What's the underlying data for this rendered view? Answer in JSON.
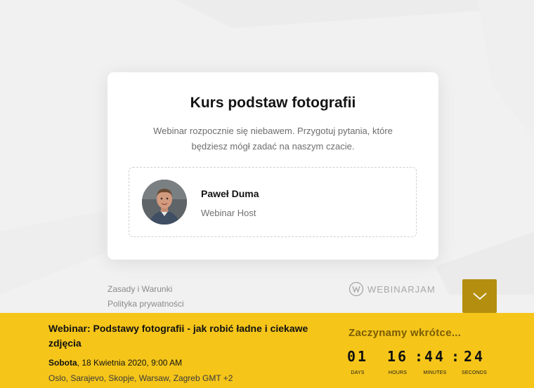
{
  "card": {
    "title": "Kurs podstaw fotografii",
    "description": "Webinar rozpocznie się niebawem. Przygotuj pytania, które będziesz mógł zadać na naszym czacie."
  },
  "host": {
    "name": "Paweł Duma",
    "role": "Webinar Host"
  },
  "footer": {
    "terms": "Zasady i Warunki",
    "privacy": "Polityka prywatności",
    "brand": "WEBINARJAM"
  },
  "event": {
    "title": "Webinar: Podstawy fotografii - jak robić ładne i ciekawe zdjęcia",
    "day": "Sobota",
    "date": ", 18 Kwietnia 2020, 9:00 AM",
    "timezone": "Oslo, Sarajevo, Skopje, Warsaw, Zagreb GMT +2"
  },
  "countdown": {
    "heading": "Zaczynamy wkrótce...",
    "days": "01",
    "days_label": "DAYS",
    "hours": "16",
    "hours_label": "HOURS",
    "minutes": "44",
    "minutes_label": "MINUTES",
    "seconds": "24",
    "seconds_label": "SECONDS",
    "separator": ":"
  },
  "colors": {
    "accent_bar": "#f5c51a",
    "scroll_button": "#b48f0f",
    "heading_text": "#7a5d05"
  },
  "icons": {
    "scroll": "chevron-down-icon",
    "brand": "webinarjam-logo-icon"
  }
}
